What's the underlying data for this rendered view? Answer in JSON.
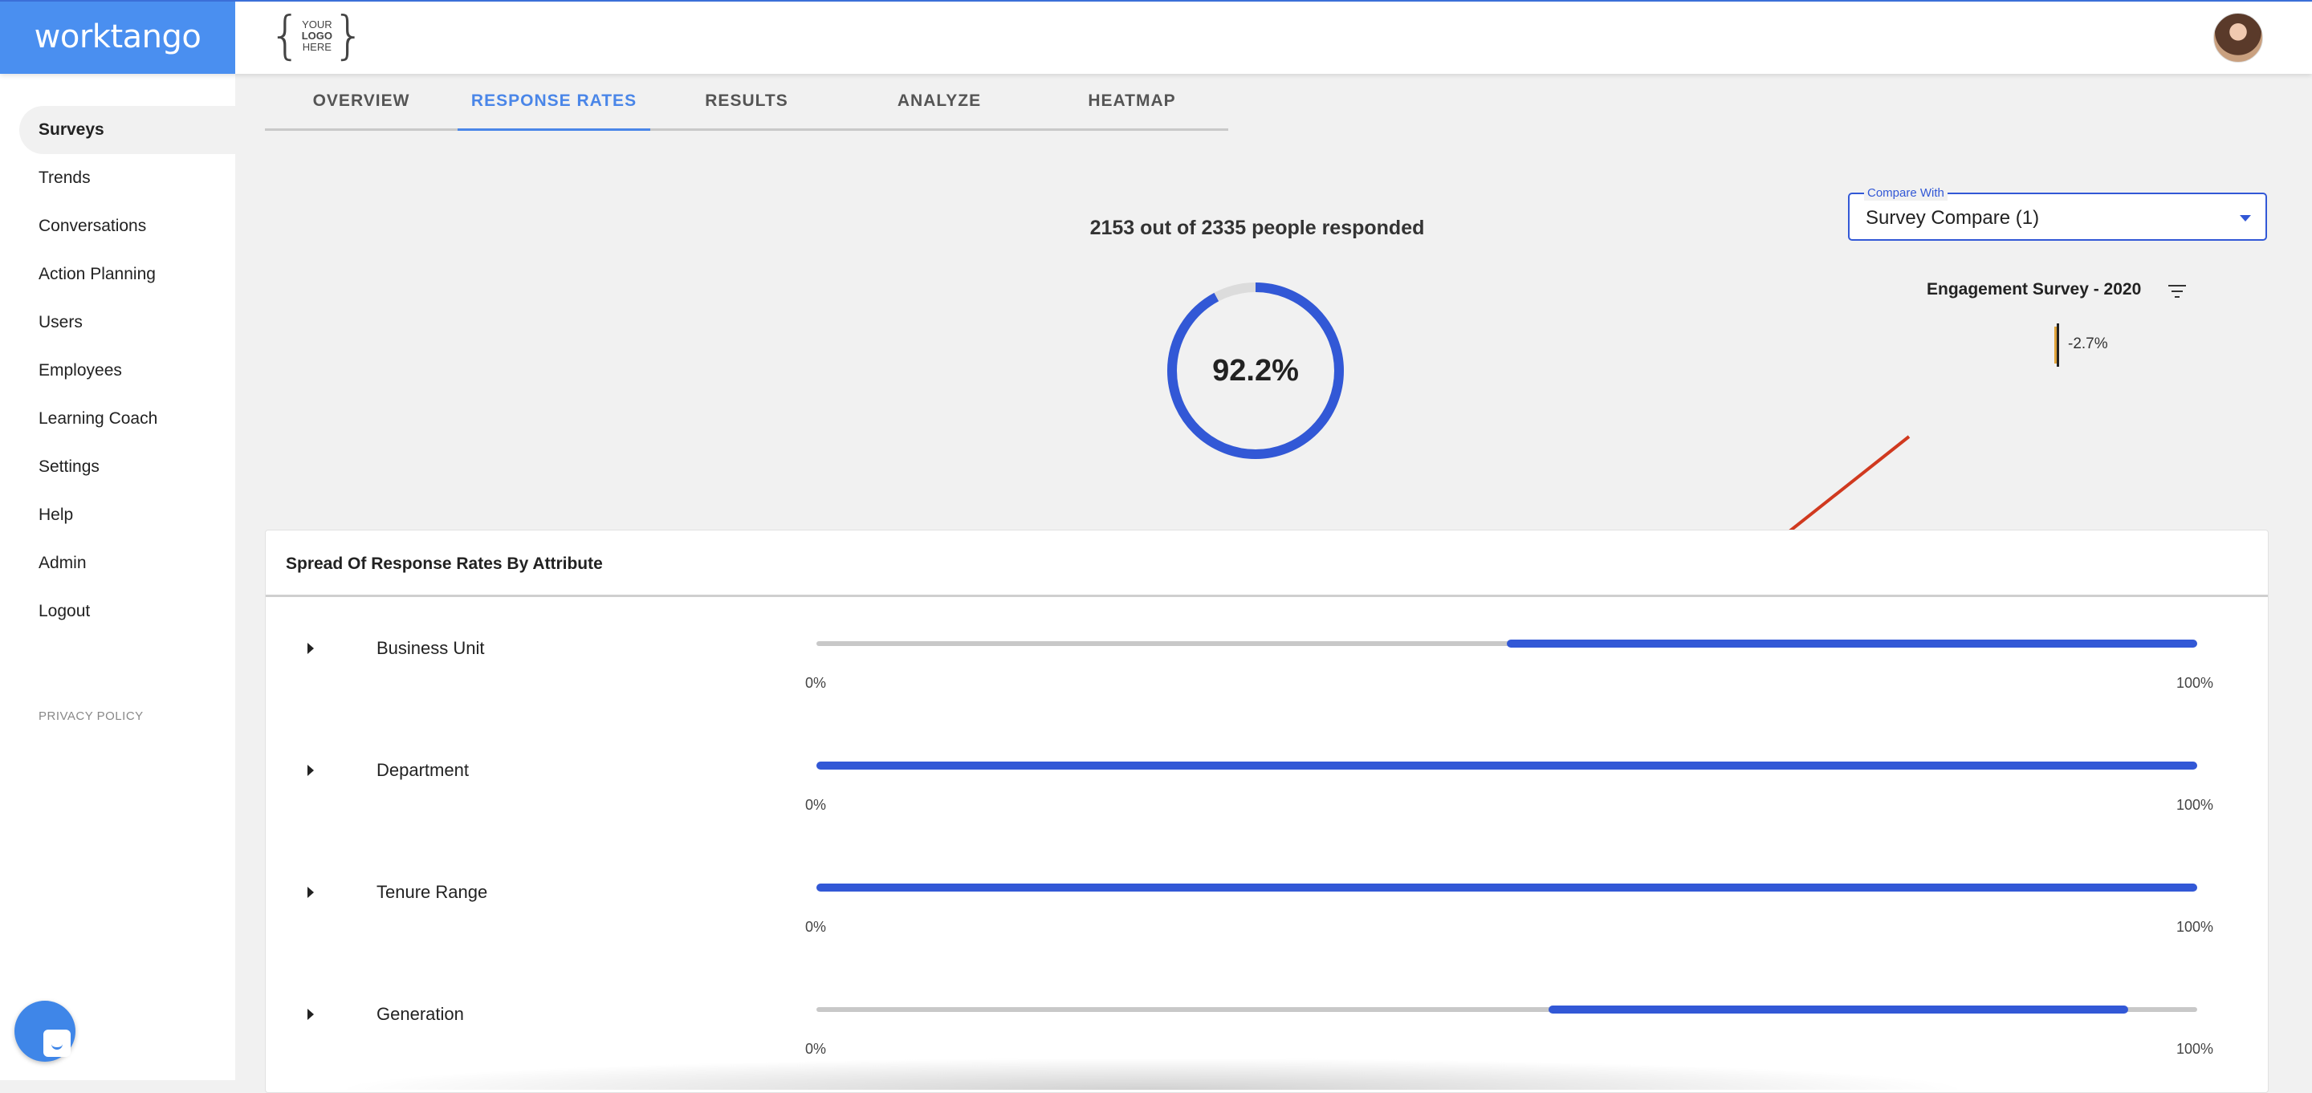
{
  "header": {
    "brand": "worktango",
    "logo_top": "YOUR",
    "logo_mid": "LOGO",
    "logo_bottom": "HERE"
  },
  "sidebar": {
    "items": [
      {
        "label": "Surveys",
        "active": true
      },
      {
        "label": "Trends"
      },
      {
        "label": "Conversations"
      },
      {
        "label": "Action Planning"
      },
      {
        "label": "Users"
      },
      {
        "label": "Employees"
      },
      {
        "label": "Learning Coach"
      },
      {
        "label": "Settings"
      },
      {
        "label": "Help"
      },
      {
        "label": "Admin"
      },
      {
        "label": "Logout"
      }
    ],
    "privacy": "PRIVACY POLICY"
  },
  "tabs": [
    {
      "label": "OVERVIEW"
    },
    {
      "label": "RESPONSE RATES",
      "active": true
    },
    {
      "label": "RESULTS"
    },
    {
      "label": "ANALYZE"
    },
    {
      "label": "HEATMAP"
    }
  ],
  "summary": {
    "responded_text": "2153 out of 2335 people responded",
    "rate_label": "92.2%",
    "rate": 0.922
  },
  "compare": {
    "label": "Compare With",
    "value": "Survey Compare (1)"
  },
  "engagement": {
    "title": "Engagement Survey - 2020",
    "delta": "-2.7%"
  },
  "spread": {
    "title": "Spread Of Response Rates By Attribute",
    "min_label": "0%",
    "max_label": "100%",
    "rows": [
      {
        "label": "Business Unit",
        "range": [
          0.5,
          1.0
        ]
      },
      {
        "label": "Department",
        "range": [
          0.0,
          1.0
        ]
      },
      {
        "label": "Tenure Range",
        "range": [
          0.0,
          1.0
        ]
      },
      {
        "label": "Generation",
        "range": [
          0.53,
          0.95
        ]
      }
    ]
  },
  "colors": {
    "brand": "#4a8ff0",
    "accent": "#3258d6",
    "tab_active": "#4a86e8",
    "annotation_arrow": "#d0391f"
  }
}
